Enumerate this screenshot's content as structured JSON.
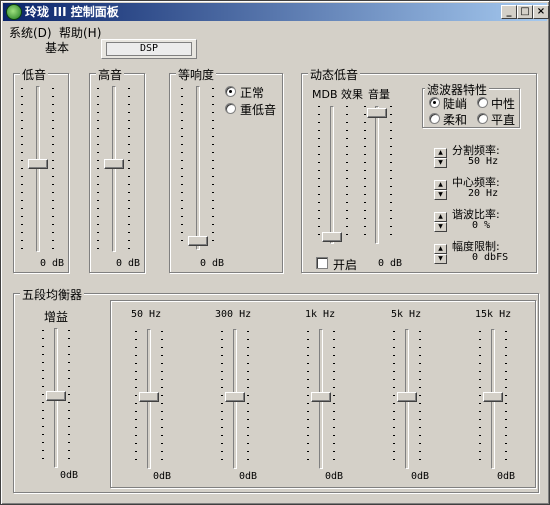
{
  "window": {
    "title": "玲珑 III 控制面板",
    "minimize": "_",
    "maximize": "□",
    "close": "×"
  },
  "menu": {
    "system": "系统(D)",
    "help": "帮助(H)"
  },
  "tabs": {
    "basic": "基本",
    "dsp": "DSP"
  },
  "bass": {
    "title": "低音",
    "value": "0 dB",
    "level": 0.5
  },
  "treble": {
    "title": "高音",
    "value": "0 dB",
    "level": 0.5
  },
  "loudness": {
    "title": "等响度",
    "value": "0 dB",
    "level": 0.0,
    "normal_label": "正常",
    "heavy_label": "重低音",
    "selected": "normal"
  },
  "dynamic_bass": {
    "title": "动态低音",
    "mdb_label": "MDB 效果",
    "volume_label": "音量",
    "enable_label": "开启",
    "enabled": false,
    "value": "0 dB",
    "mdb_level": 0.0,
    "volume_level": 1.0,
    "filter": {
      "title": "滤波器特性",
      "steep": "陡峭",
      "neutral": "中性",
      "soft": "柔和",
      "flat": "平直",
      "selected": "steep"
    },
    "params": [
      {
        "label": "分割频率:",
        "value": "50 Hz"
      },
      {
        "label": "中心频率:",
        "value": "20 Hz"
      },
      {
        "label": "谐波比率:",
        "value": "0 %"
      },
      {
        "label": "幅度限制:",
        "value": "0 dbFS"
      }
    ]
  },
  "equalizer": {
    "title": "五段均衡器",
    "gain_label": "增益",
    "gain_value": "0dB",
    "gain_level": 0.5,
    "bands": [
      {
        "label": "50 Hz",
        "value": "0dB",
        "level": 0.5
      },
      {
        "label": "300 Hz",
        "value": "0dB",
        "level": 0.5
      },
      {
        "label": "1k Hz",
        "value": "0dB",
        "level": 0.5
      },
      {
        "label": "5k Hz",
        "value": "0dB",
        "level": 0.5
      },
      {
        "label": "15k Hz",
        "value": "0dB",
        "level": 0.5
      }
    ]
  }
}
